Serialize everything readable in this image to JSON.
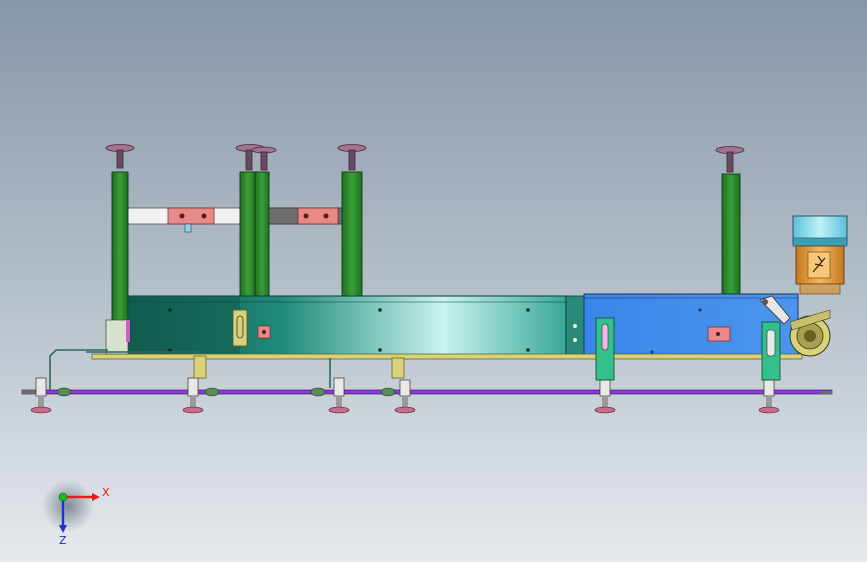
{
  "axis_triad": {
    "x_label": "X",
    "z_label": "Z",
    "x_color": "#e0201c",
    "z_color": "#2230c8",
    "origin_color": "#18c020"
  },
  "colors": {
    "background_top": "#8796a8",
    "background_bottom": "#e4e8ec",
    "frame_green": "#2f8a2f",
    "conveyor_teal_dark": "#167a6a",
    "conveyor_teal_light": "#c8f0ec",
    "drive_blue": "#3a86e8",
    "motor_cyan": "#7fdcec",
    "gearbox_orange": "#e8a03a",
    "tie_rod_purple": "#8a3ad8",
    "bracket_pink": "#e88888",
    "handwheel_purple": "#a07090"
  }
}
